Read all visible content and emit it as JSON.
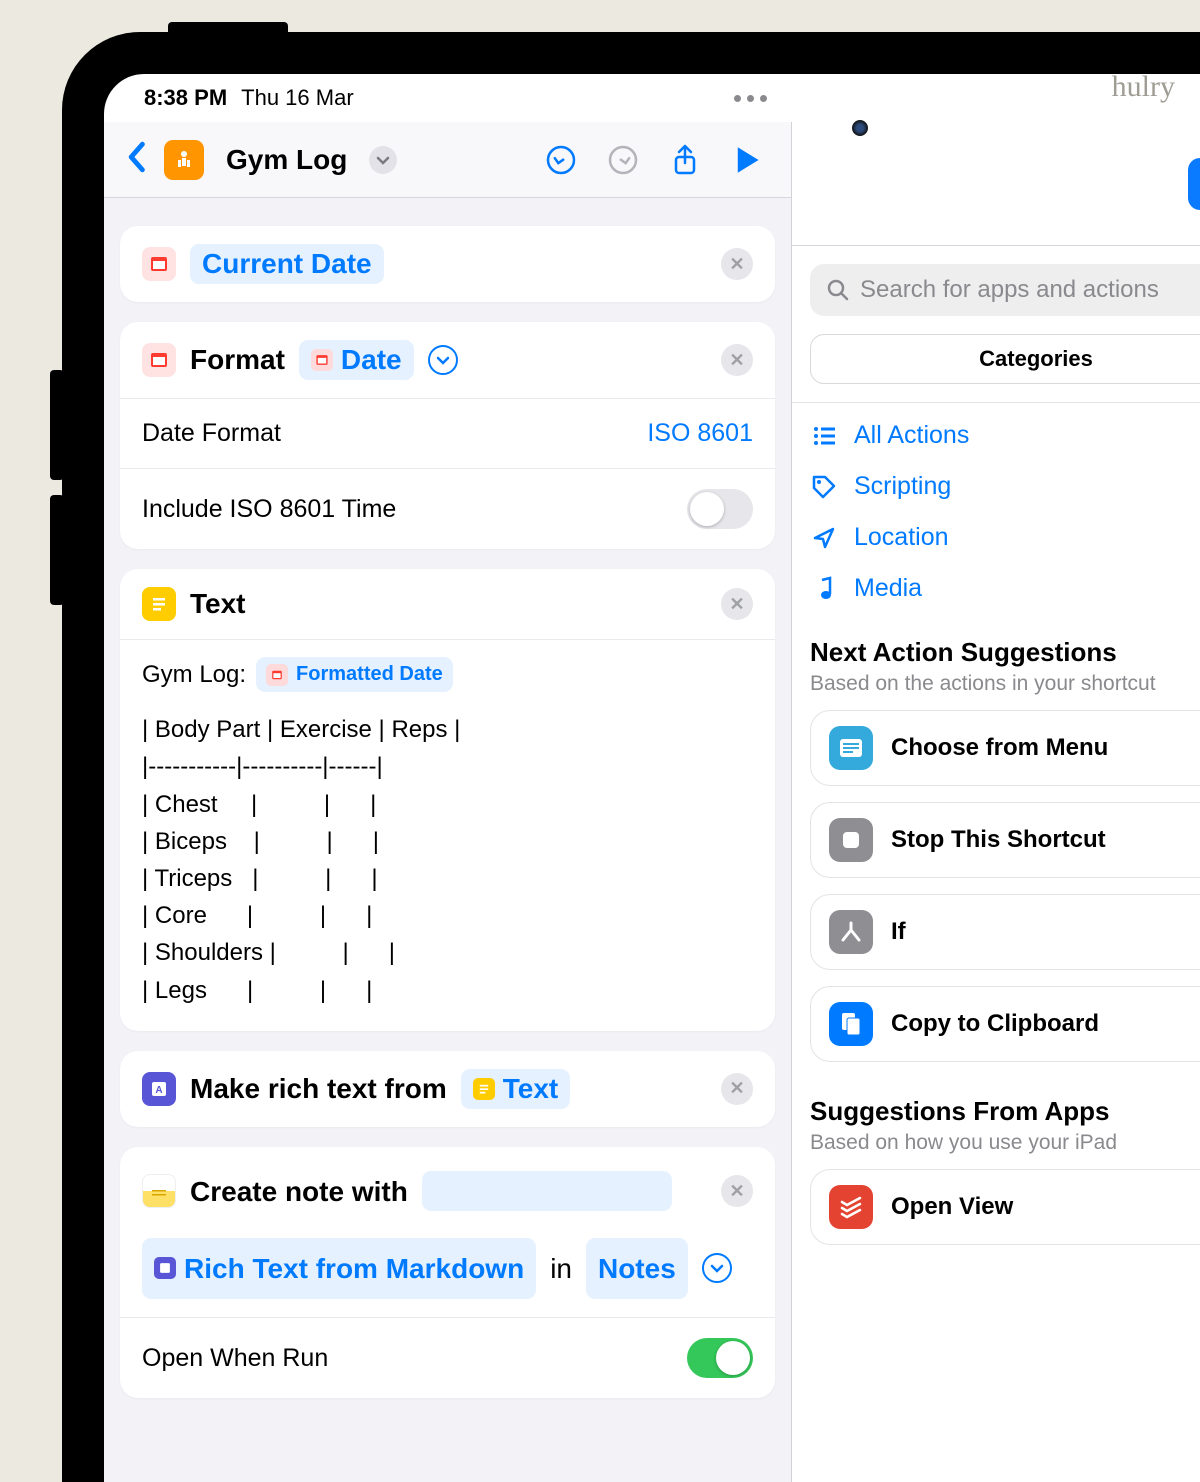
{
  "watermark": "hulry",
  "status": {
    "time": "8:38 PM",
    "date": "Thu 16 Mar"
  },
  "toolbar": {
    "shortcut_title": "Gym Log"
  },
  "actions": {
    "current_date": {
      "label": "Current Date"
    },
    "format": {
      "verb": "Format",
      "token": "Date",
      "rows": {
        "date_format_label": "Date Format",
        "date_format_value": "ISO 8601",
        "include_time_label": "Include ISO 8601 Time",
        "include_time_on": false
      }
    },
    "text": {
      "title": "Text",
      "prefix": "Gym Log:",
      "token": "Formatted Date",
      "body": "| Body Part | Exercise | Reps |\n|-----------|----------|------|\n| Chest     |          |      |\n| Biceps    |          |      |\n| Triceps   |          |      |\n| Core      |          |      |\n| Shoulders |          |      |\n| Legs      |          |      |"
    },
    "rich_text": {
      "verb": "Make rich text from",
      "token": "Text"
    },
    "create_note": {
      "verb": "Create note with",
      "token": "Rich Text from Markdown",
      "in_word": "in",
      "app_token": "Notes",
      "open_when_run_label": "Open When Run",
      "open_when_run_on": true
    }
  },
  "right": {
    "search_placeholder": "Search for apps and actions",
    "segment_label": "Categories",
    "categories": {
      "all": "All Actions",
      "scripting": "Scripting",
      "location": "Location",
      "media": "Media"
    },
    "next_heading": "Next Action Suggestions",
    "next_sub": "Based on the actions in your shortcut",
    "suggestions": {
      "choose": "Choose from Menu",
      "stop": "Stop This Shortcut",
      "if": "If",
      "clipboard": "Copy to Clipboard"
    },
    "from_heading": "Suggestions From Apps",
    "from_sub": "Based on how you use your iPad",
    "from_items": {
      "open_view": "Open View"
    }
  }
}
